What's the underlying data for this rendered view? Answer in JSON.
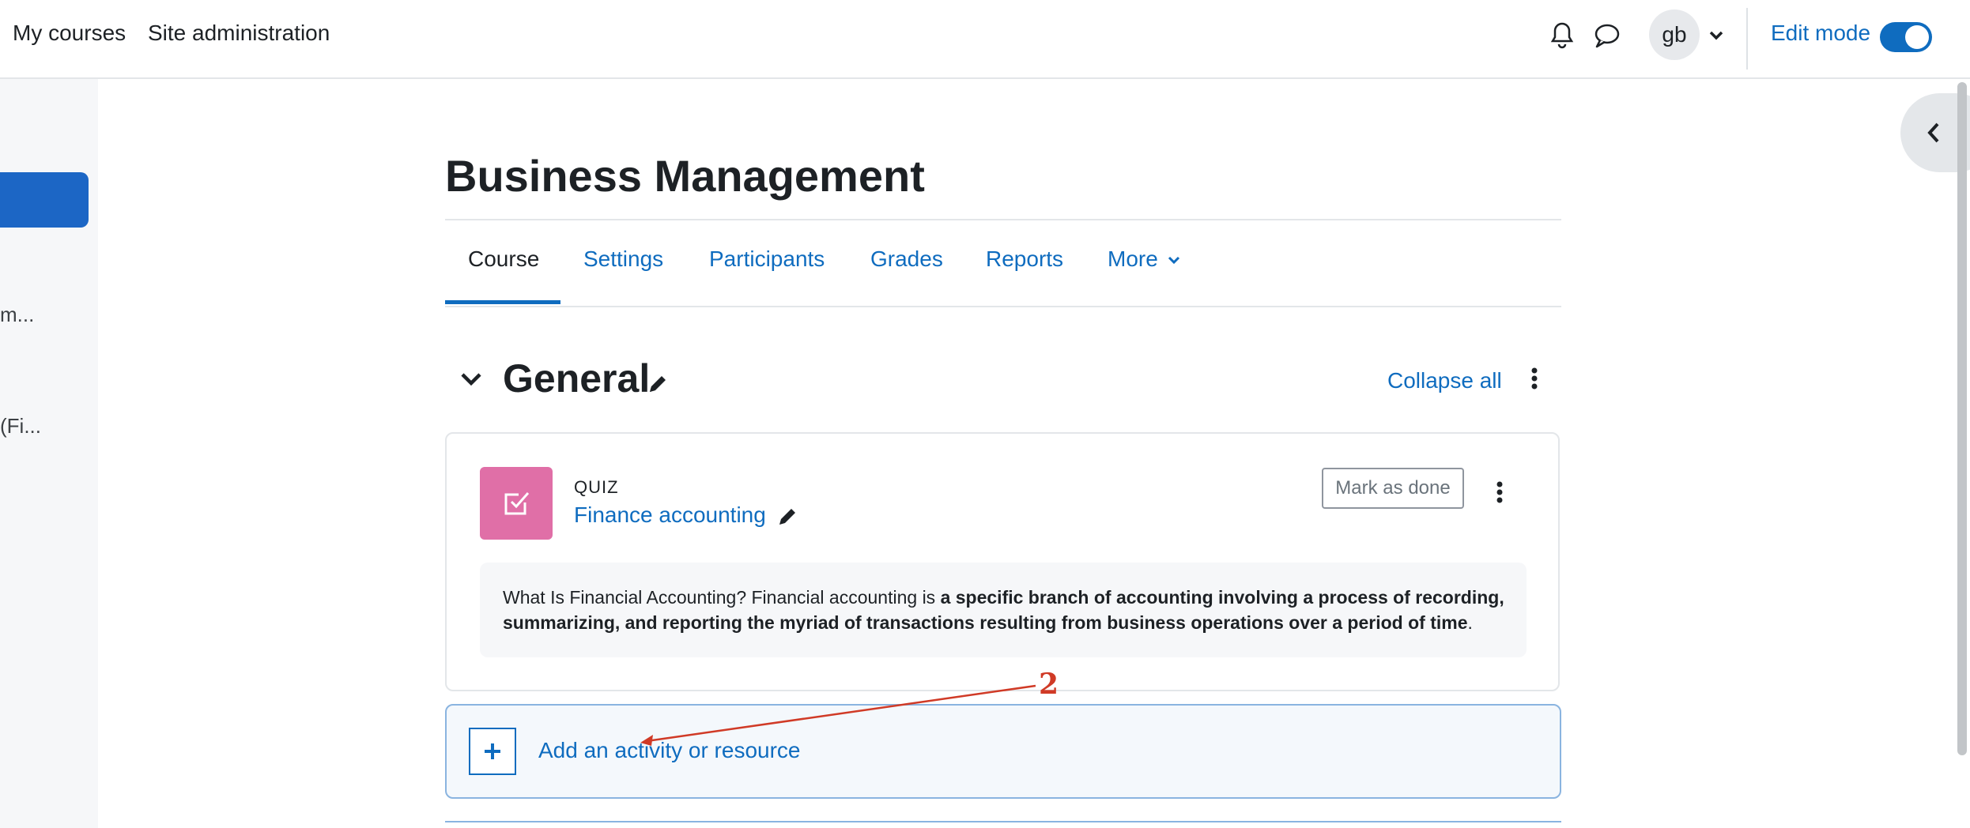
{
  "navbar": {
    "my_courses": "My courses",
    "site_admin": "Site administration",
    "avatar_initials": "gb",
    "edit_mode_label": "Edit mode",
    "edit_mode_on": true
  },
  "drawer": {
    "item1_text": "m...",
    "item2_text": "(Fi..."
  },
  "course": {
    "title": "Business Management",
    "tabs": [
      {
        "label": "Course"
      },
      {
        "label": "Settings"
      },
      {
        "label": "Participants"
      },
      {
        "label": "Grades"
      },
      {
        "label": "Reports"
      },
      {
        "label": "More"
      }
    ]
  },
  "section": {
    "title": "General",
    "collapse_all": "Collapse all"
  },
  "activity": {
    "type_label": "QUIZ",
    "name": "Finance accounting",
    "mark_done_label": "Mark as done",
    "description_plain": "What Is Financial Accounting? Financial accounting is ",
    "description_bold": "a specific branch of accounting involving a process of recording, summarizing, and reporting the myriad of transactions resulting from business operations over a period of time",
    "description_end": ".",
    "icon_color": "#e06fa7"
  },
  "add_activity": {
    "label": "Add an activity or resource"
  },
  "annotation": {
    "number": "2",
    "color": "#d03a26"
  },
  "colors": {
    "primary": "#0f6cbf",
    "text": "#1d2125"
  }
}
